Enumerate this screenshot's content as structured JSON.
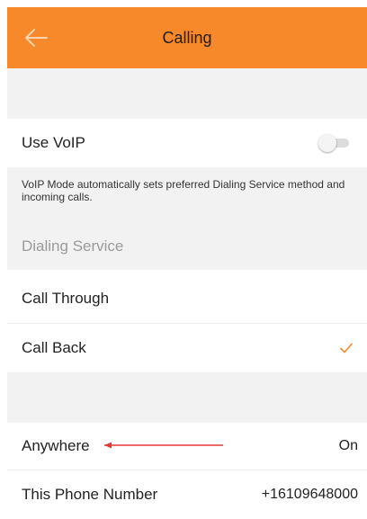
{
  "header": {
    "title": "Calling",
    "background": "#f7892b",
    "back_icon": "arrow-left-icon"
  },
  "voip": {
    "label": "Use VoIP",
    "enabled": false,
    "description": "VoIP Mode automatically sets preferred Dialing Service method and incoming calls."
  },
  "dialing_service": {
    "section_label": "Dialing Service",
    "options": [
      {
        "label": "Call Through",
        "selected": false
      },
      {
        "label": "Call Back",
        "selected": true
      }
    ],
    "check_color": "#f7892b"
  },
  "anywhere": {
    "label": "Anywhere",
    "value": "On",
    "annotation_color": "#e53935"
  },
  "this_phone": {
    "label": "This Phone Number",
    "value": "+16109648000"
  }
}
